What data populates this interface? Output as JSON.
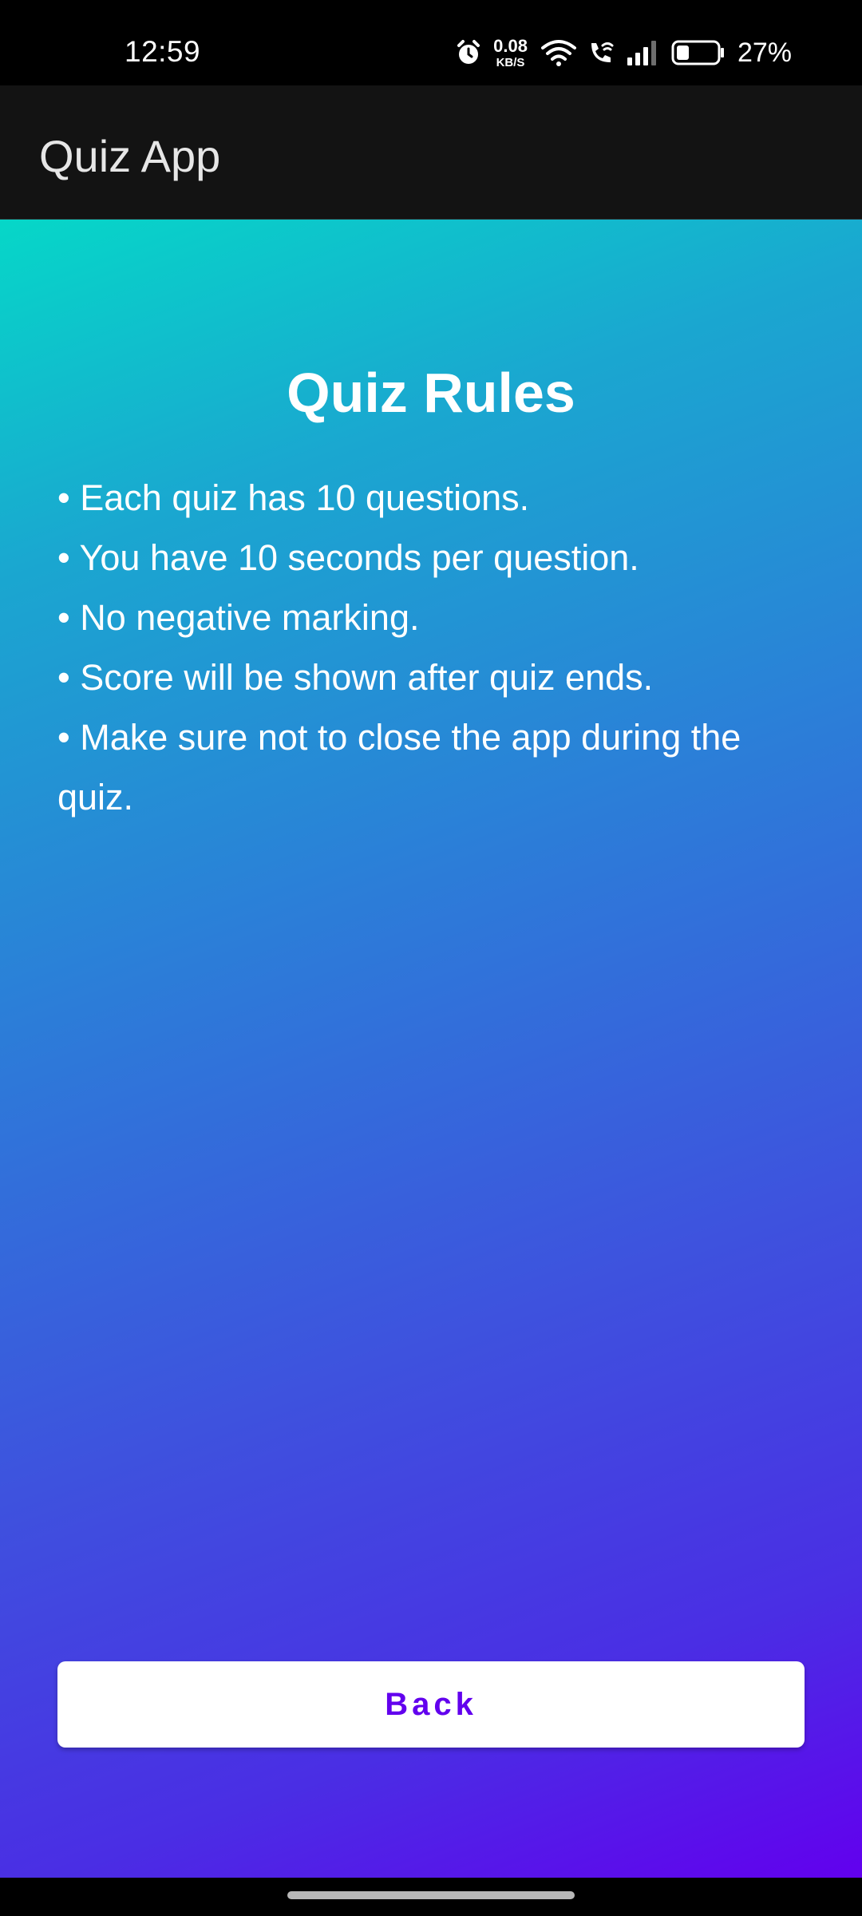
{
  "status_bar": {
    "time": "12:59",
    "net_speed_value": "0.08",
    "net_speed_unit": "KB/S",
    "battery_percent": "27%",
    "battery_level": 0.27,
    "icons": [
      "alarm-icon",
      "wifi-icon",
      "wifi-calling-icon",
      "signal-icon",
      "battery-icon"
    ]
  },
  "app_bar": {
    "title": "Quiz App"
  },
  "rules": {
    "title": "Quiz Rules",
    "items": [
      "• Each quiz has 10 questions.",
      "• You have 10 seconds per question.",
      "• No negative marking.",
      "• Score will be shown after quiz ends.",
      "• Make sure not to close the app during the quiz."
    ]
  },
  "back_button": {
    "label": "Back"
  },
  "colors": {
    "accent": "#6200ee",
    "gradient_start": "#06d7c8",
    "gradient_end": "#6200ee",
    "app_bar": "#131313"
  }
}
